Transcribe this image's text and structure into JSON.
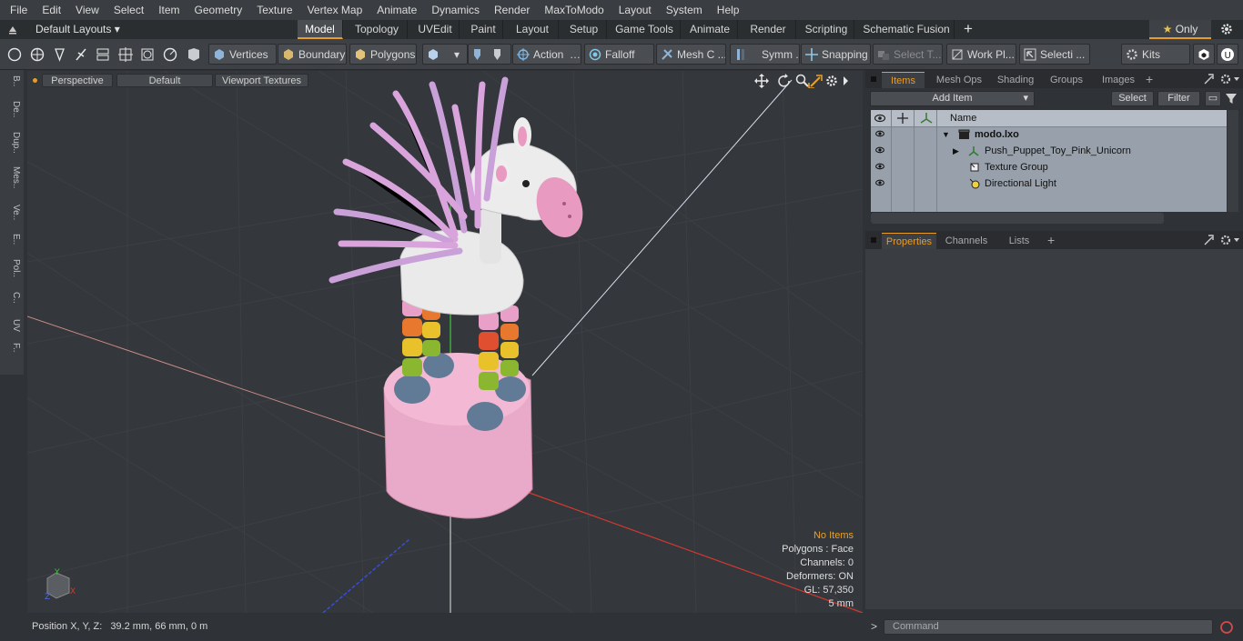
{
  "menu": [
    "File",
    "Edit",
    "View",
    "Select",
    "Item",
    "Geometry",
    "Texture",
    "Vertex Map",
    "Animate",
    "Dynamics",
    "Render",
    "MaxToModo",
    "Layout",
    "System",
    "Help"
  ],
  "layout_selector": "Default Layouts",
  "tabs": [
    "Model",
    "Topology",
    "UVEdit",
    "Paint",
    "Layout",
    "Setup",
    "Game Tools",
    "Animate",
    "Render",
    "Scripting",
    "Schematic Fusion"
  ],
  "only_label": "Only",
  "toolbar": {
    "vertices": "Vertices",
    "boundary": "Boundary",
    "polygons": "Polygons",
    "action": "Action",
    "falloff": "Falloff",
    "mesh": "Mesh C ...",
    "symm": "Symm ...",
    "snapping": "Snapping",
    "select_t": "Select T...",
    "work_plane": "Work Pl...",
    "selecti": "Selecti ...",
    "kits": "Kits"
  },
  "left_strip": [
    "B..",
    "De..",
    "Dup..",
    "Mes..",
    "Ve..",
    "E..",
    "Pol..",
    "C..",
    "UV",
    "F.."
  ],
  "viewport": {
    "view": "Perspective",
    "shading": "Default",
    "textures": "Viewport Textures",
    "info": {
      "no_items": "No Items",
      "polygons": "Polygons : Face",
      "channels": "Channels: 0",
      "deformers": "Deformers: ON",
      "gl": "GL: 57,350",
      "scale": "5 mm"
    }
  },
  "position_bar": {
    "label": "Position X, Y, Z:",
    "value": "39.2 mm, 66 mm, 0 m"
  },
  "items_panel": {
    "tabs": [
      "Items",
      "Mesh Ops",
      "Shading",
      "Groups",
      "Images"
    ],
    "add_item": "Add Item",
    "select": "Select",
    "filter": "Filter",
    "name_header": "Name",
    "rows": [
      "modo.lxo",
      "Push_Puppet_Toy_Pink_Unicorn",
      "Texture Group",
      "Directional Light"
    ]
  },
  "props_panel": {
    "tabs": [
      "Properties",
      "Channels",
      "Lists"
    ]
  },
  "command_placeholder": "Command",
  "colors": {
    "accent": "#e89d2a",
    "item_list_bg": "#97a0ab",
    "viewport_bg": "#34373b"
  }
}
